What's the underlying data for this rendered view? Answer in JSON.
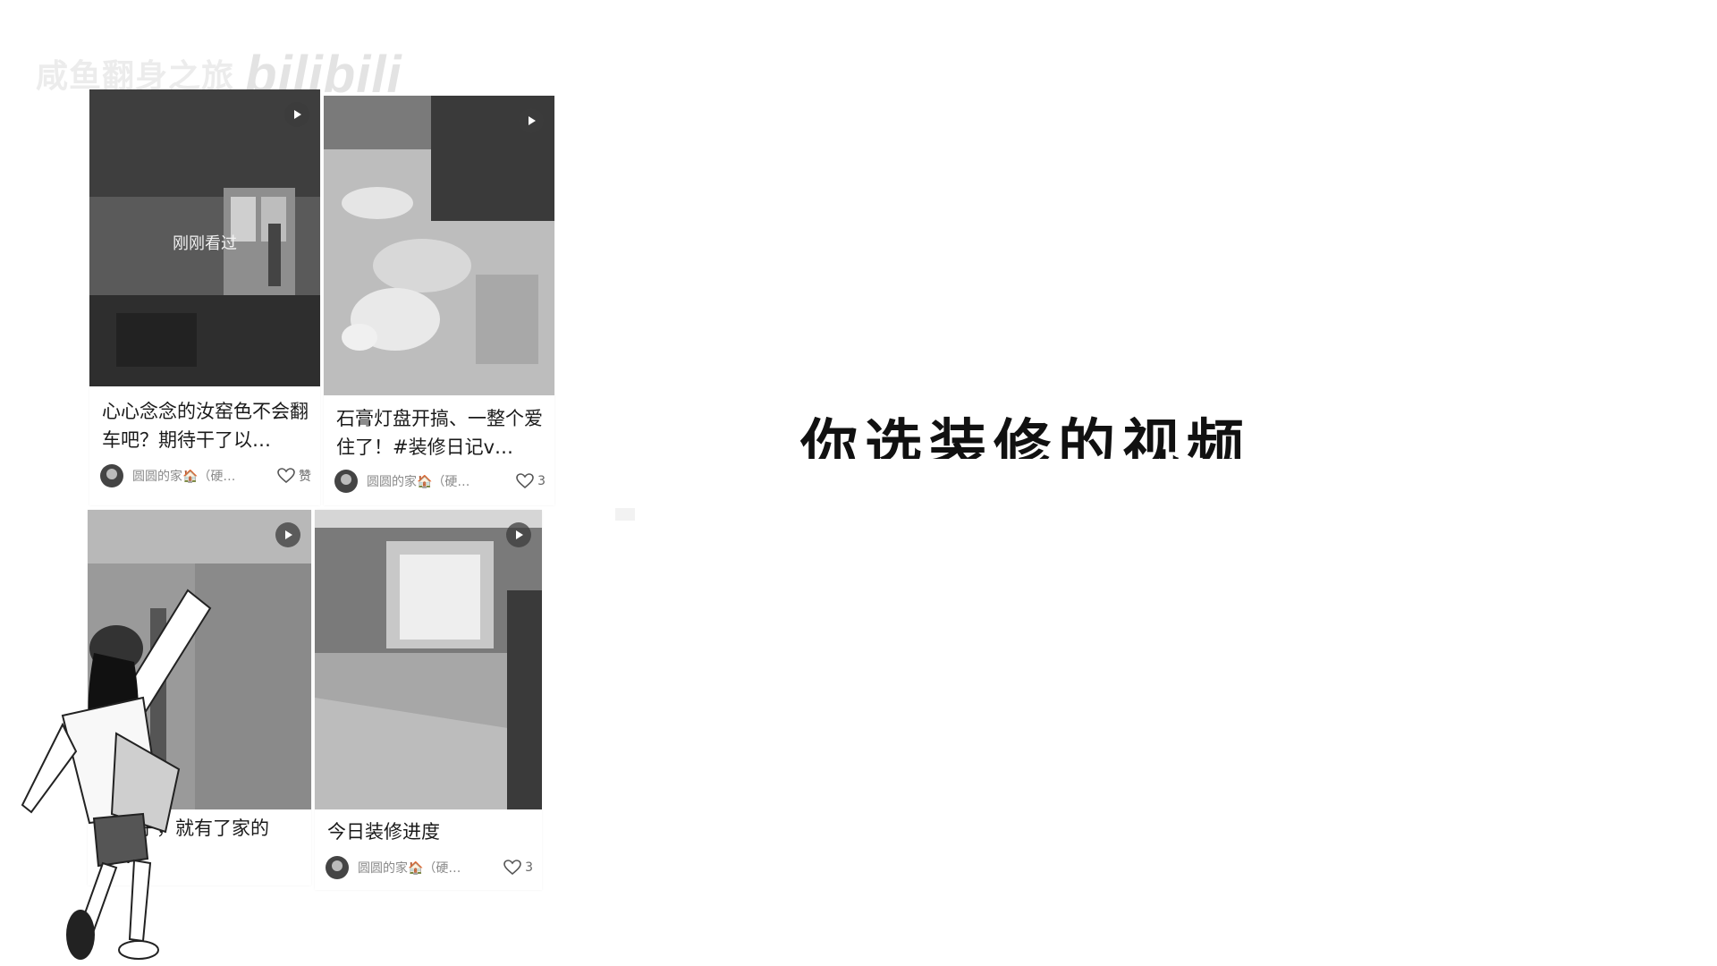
{
  "watermark": {
    "channel": "咸鱼翻身之旅",
    "brand": "bilibili"
  },
  "feed": {
    "cards": [
      {
        "title": "心心念念的汝窑色不会翻车吧？期待干了以…",
        "author": "圆圆的家🏠（硬…",
        "likes": "赞",
        "seen_label": "刚刚看过",
        "type": "video"
      },
      {
        "title": "石膏灯盘开搞、一整个爱住了！#装修日记v…",
        "author": "圆圆的家🏠（硬…",
        "likes": "3",
        "type": "video"
      },
      {
        "title": "刮腻子，就有了家的感…",
        "author": "",
        "likes": "",
        "type": "video"
      },
      {
        "title": "今日装修进度",
        "author": "圆圆的家🏠（硬…",
        "likes": "3",
        "type": "video"
      }
    ]
  },
  "headline": {
    "text": "你选装修的视频"
  },
  "icons": {
    "play": "play-icon",
    "like": "heart-icon",
    "avatar": "avatar"
  },
  "colors": {
    "background": "#ffffff",
    "text": "#1a1a1a",
    "meta": "#8a8a8a"
  }
}
